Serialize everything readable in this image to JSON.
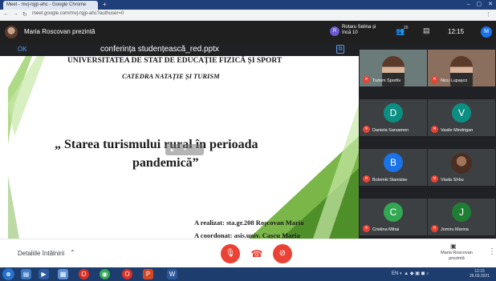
{
  "browser": {
    "tab_title": "Meet - mvj-rqjp-ahc - Google Chrome",
    "url": "meet.google.com/mvj-rqjp-ahc?authuser=0"
  },
  "meet_header": {
    "presenter_label": "Maria Roscovan prezintă",
    "raised_hand_initials": "R",
    "raised_hand_text": "Rotaru Selina și încă 10",
    "people_count": "25",
    "clock": "12:15",
    "user_initial": "M"
  },
  "presentation": {
    "ok_label": "OK",
    "file_name": "conferința studențească_red.pptx",
    "slide": {
      "university": "UNIVERSITATEA DE STAT DE EDUCAȚIE FIZICĂ ȘI SPORT",
      "department": "CATEDRA NATAȚIE ȘI TURISM",
      "title_line1": "„ Starea turismului rural în perioada",
      "title_line2": "pandemică”",
      "author": "A realizat: sta.gr.208 Roșcovan Maria",
      "coordinator": "A coordonat: asis.univ. Cașcu Maria"
    }
  },
  "participants": [
    {
      "name": "Turism Sportiv",
      "type": "video",
      "color": "#6b7b79"
    },
    {
      "name": "Nicu Lupașco",
      "type": "video",
      "color": "#8a6e5e"
    },
    {
      "name": "Daniela Sarsamen",
      "type": "letter",
      "letter": "D",
      "color": "#0b8f82"
    },
    {
      "name": "Vasile Mindrigan",
      "type": "letter",
      "letter": "V",
      "color": "#0b8f82"
    },
    {
      "name": "Bolomki Stanislav",
      "type": "letter",
      "letter": "B",
      "color": "#1a73e8"
    },
    {
      "name": "Vlada Sîrbu",
      "type": "photo",
      "color": "#3c4043"
    },
    {
      "name": "Cristina Mihai",
      "type": "letter",
      "letter": "C",
      "color": "#33a852"
    },
    {
      "name": "Jomiru Marina",
      "type": "letter",
      "letter": "J",
      "color": "#1e7e34"
    }
  ],
  "bottom_bar": {
    "details_label": "Detaliile întâlnirii",
    "presenting_label": "Maria Roscovan prezintă"
  },
  "taskbar": {
    "tray_lang": "EN",
    "tray_time": "12:15",
    "tray_date": "26.03.2021"
  },
  "colors": {
    "meet_dark": "#202124",
    "accent_red": "#ea4335",
    "slide_green": "#7ab648"
  }
}
